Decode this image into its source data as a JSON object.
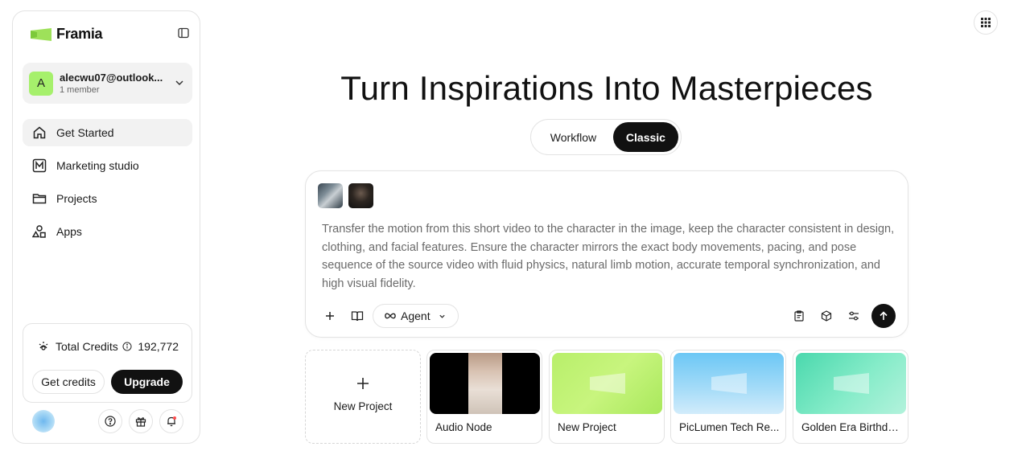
{
  "brand": {
    "name": "Framia"
  },
  "account": {
    "email": "alecwu07@outlook...",
    "members": "1 member",
    "initial": "A"
  },
  "nav": {
    "items": [
      {
        "label": "Get Started",
        "icon": "home-icon",
        "active": true
      },
      {
        "label": "Marketing studio",
        "icon": "m-square-icon",
        "active": false
      },
      {
        "label": "Projects",
        "icon": "folder-icon",
        "active": false
      },
      {
        "label": "Apps",
        "icon": "shapes-icon",
        "active": false
      }
    ]
  },
  "credits": {
    "label": "Total Credits",
    "value": "192,772",
    "get_label": "Get credits",
    "upgrade_label": "Upgrade"
  },
  "hero": {
    "title": "Turn Inspirations Into Masterpieces"
  },
  "mode": {
    "workflow_label": "Workflow",
    "classic_label": "Classic",
    "selected": "Classic"
  },
  "prompt": {
    "text": "Transfer the motion from this short video to the character in the image, keep the character consistent in design, clothing, and facial features. Ensure the character mirrors the exact body movements, pacing, and pose sequence of the source video with fluid physics, natural limb motion, accurate temporal synchronization, and high visual fidelity.",
    "agent_label": "Agent"
  },
  "projects": {
    "new_label": "New Project",
    "cards": [
      {
        "title": "Audio Node"
      },
      {
        "title": "New Project"
      },
      {
        "title": "PicLumen Tech Re..."
      },
      {
        "title": "Golden Era Birthda..."
      }
    ]
  },
  "colors": {
    "accent_green": "#a6f06c",
    "primary_dark": "#111111",
    "border": "#e3e3e3"
  }
}
